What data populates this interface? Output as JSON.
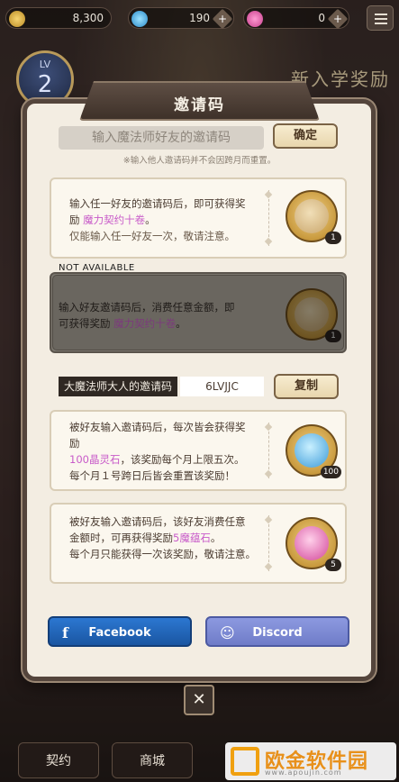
{
  "topbar": {
    "gold": "8,300",
    "gems": "190",
    "crystals": "0",
    "plus": "+"
  },
  "level": {
    "label": "LV",
    "value": "2"
  },
  "background_banner": "新入学奖励",
  "dialog": {
    "title": "邀请码",
    "input_placeholder": "输入魔法师好友的邀请码",
    "confirm_button": "确定",
    "note": "※输入他人邀请码并不会因跨月而重置。",
    "reward_card_1": {
      "line1": "输入任一好友的邀请码后，即可获得奖",
      "line2_prefix": "励 ",
      "line2_highlight": "魔力契约十卷",
      "line2_suffix": "。",
      "line3": "仅能输入任一好友一次，敬请注意。",
      "reward_count": "1"
    },
    "not_available_label": "NOT AVAILABLE",
    "reward_card_2": {
      "line1": "输入好友邀请码后，消费任意金额，即",
      "line2_prefix": "可获得奖励 ",
      "line2_highlight": "魔力契约十卷",
      "line2_suffix": "。",
      "reward_count": "1"
    },
    "my_code_label": "大魔法师大人的邀请码",
    "my_code_value": "6LVJJC",
    "copy_button": "复制",
    "reward_card_3": {
      "line1": "被好友输入邀请码后，每次皆会获得奖",
      "line2": "励",
      "line3_highlight": "100晶灵石",
      "line3_suffix": "，该奖励每个月上限五次。",
      "line4": "每个月１号跨日后皆会重置该奖励！",
      "reward_count": "100"
    },
    "reward_card_4": {
      "line1": "被好友输入邀请码后，该好友消费任意",
      "line2_prefix": "金额时，可再获得奖励",
      "line2_highlight": "5魔蕴石",
      "line2_suffix": "。",
      "line3": "每个月只能获得一次该奖励，敬请注意。",
      "reward_count": "5"
    },
    "facebook_button": "Facebook",
    "discord_button": "Discord",
    "close_button": "✕"
  },
  "bottom_nav": {
    "tab_contract": "契约",
    "tab_shop": "商城"
  },
  "watermark": {
    "name": "欧金软件园",
    "url": "www.apoujin.com"
  },
  "colors": {
    "facebook": "#1e63b8",
    "discord": "#7c8ad6",
    "highlight": "#c85bc9"
  }
}
